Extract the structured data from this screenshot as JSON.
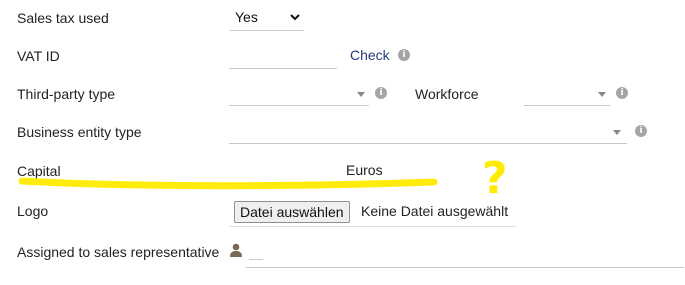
{
  "fields": {
    "sales_tax": {
      "label": "Sales tax used",
      "value": "Yes"
    },
    "vat_id": {
      "label": "VAT ID",
      "value": "",
      "check_link": "Check"
    },
    "third_party": {
      "label": "Third-party type",
      "value": ""
    },
    "workforce": {
      "label": "Workforce",
      "value": ""
    },
    "business_entity": {
      "label": "Business entity type",
      "value": ""
    },
    "capital": {
      "label": "Capital",
      "value": "",
      "unit": "Euros"
    },
    "logo": {
      "label": "Logo",
      "button": "Datei auswählen",
      "status": "Keine Datei ausgewählt"
    },
    "sales_rep": {
      "label": "Assigned to sales representative",
      "value": ""
    }
  },
  "annotation": {
    "mark": "?",
    "color": "#ffeb00"
  },
  "icons": {
    "info": "info-icon",
    "user": "user-icon",
    "dropdown": "chevron-down-icon"
  }
}
